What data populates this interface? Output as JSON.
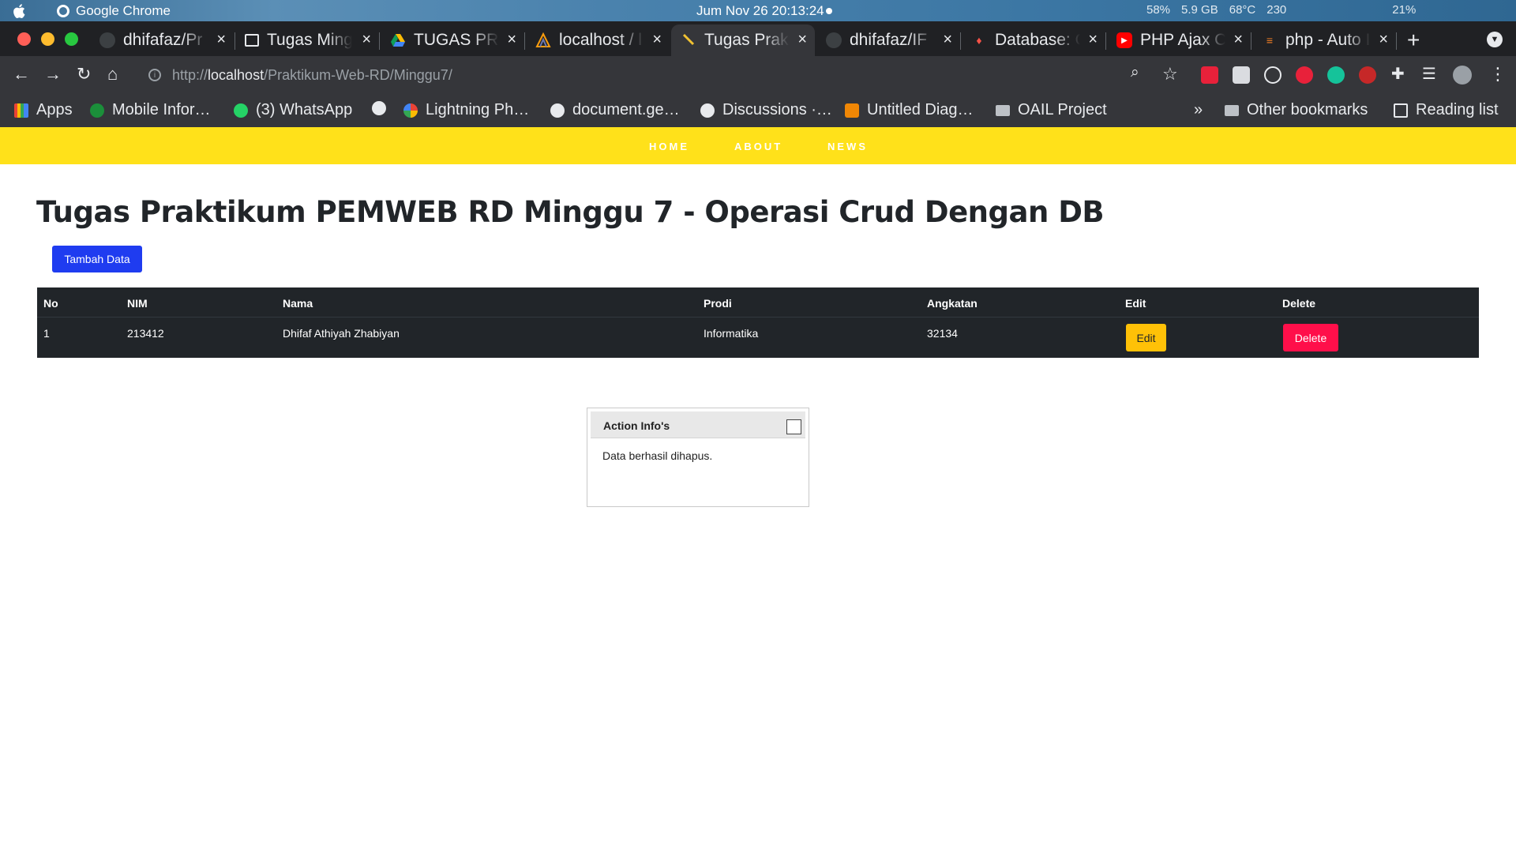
{
  "system_bar": {
    "app_name": "Google Chrome",
    "datetime": "Jum Nov 26  20:13:24",
    "status_items": [
      "58%",
      "5.9 GB",
      "68°C",
      "230",
      "21%"
    ]
  },
  "tabs": [
    {
      "title": "dhifafaz/Pr",
      "icon": "github-icon"
    },
    {
      "title": "Tugas Ming",
      "icon": "classroom-icon"
    },
    {
      "title": "TUGAS PRA",
      "icon": "google-drive-icon"
    },
    {
      "title": "localhost / l",
      "icon": "phpmyadmin-icon"
    },
    {
      "title": "Tugas Prakt",
      "icon": "localhost-icon",
      "active": true
    },
    {
      "title": "dhifafaz/IF",
      "icon": "github-icon"
    },
    {
      "title": "Database: C",
      "icon": "laravel-icon"
    },
    {
      "title": "PHP Ajax C",
      "icon": "youtube-icon"
    },
    {
      "title": "php - Auto I",
      "icon": "stackoverflow-icon"
    }
  ],
  "address_bar": {
    "scheme": "http://",
    "host": "localhost",
    "path": "/Praktikum-Web-RD/Minggu7/"
  },
  "bookmarks": [
    {
      "label": "Apps",
      "icon": "apps-grid-icon"
    },
    {
      "label": "Mobile Infor…",
      "icon": "mobile-icon"
    },
    {
      "label": "(3) WhatsApp",
      "icon": "whatsapp-icon"
    },
    {
      "label": "",
      "icon": "globe-icon"
    },
    {
      "label": "Lightning Ph…",
      "icon": "google-icon"
    },
    {
      "label": "document.ge…",
      "icon": "globe-icon"
    },
    {
      "label": "Discussions ·…",
      "icon": "globe-icon"
    },
    {
      "label": "Untitled Diag…",
      "icon": "drawio-icon"
    },
    {
      "label": "OAIL Project",
      "icon": "folder-icon"
    }
  ],
  "bookmarks_right": {
    "more": "»",
    "other": "Other bookmarks",
    "reading": "Reading list"
  },
  "site_nav": [
    "HOME",
    "ABOUT",
    "NEWS"
  ],
  "page": {
    "title": "Tugas Praktikum PEMWEB RD Minggu 7 - Operasi Crud Dengan DB",
    "add_button": "Tambah Data"
  },
  "table": {
    "headers": [
      "No",
      "NIM",
      "Nama",
      "Prodi",
      "Angkatan",
      "Edit",
      "Delete"
    ],
    "rows": [
      {
        "no": "1",
        "nim": "213412",
        "nama": "Dhifaf Athiyah Zhabiyan",
        "prodi": "Informatika",
        "angkatan": "32134",
        "edit": "Edit",
        "delete": "Delete"
      }
    ]
  },
  "dialog": {
    "title": "Action Info's",
    "message": "Data berhasil dihapus."
  },
  "colors": {
    "navbar": "#ffe11a",
    "add_button": "#1f3cf0",
    "edit_button": "#ffc107",
    "delete_button": "#ff0f4a",
    "table_bg": "#212529"
  }
}
